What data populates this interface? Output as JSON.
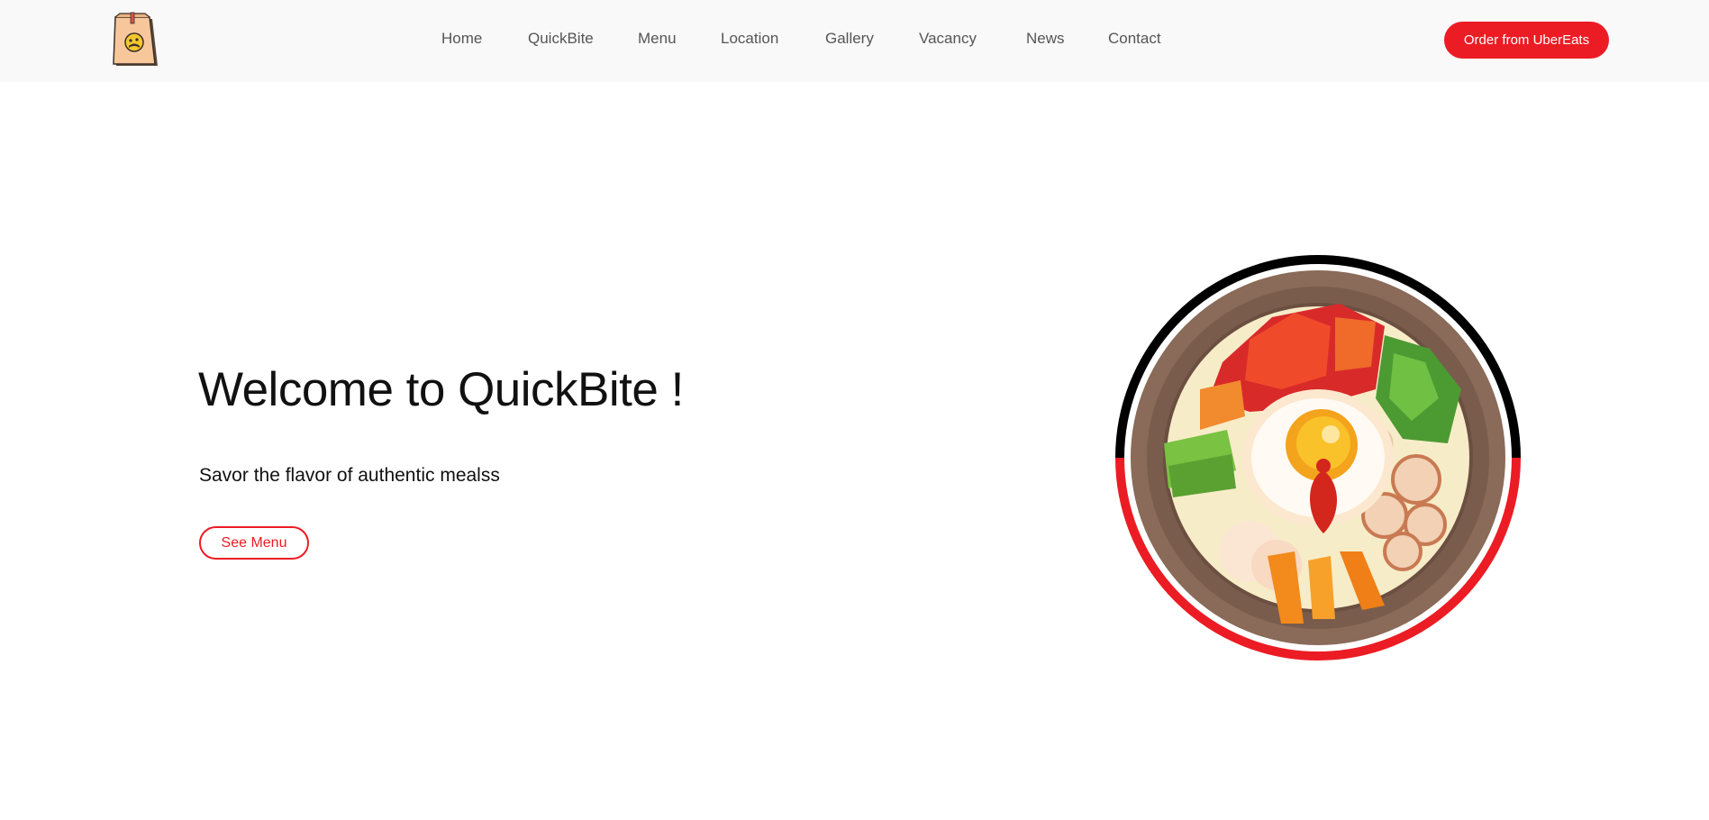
{
  "nav": {
    "logo_icon": "paper-bag-logo-icon",
    "links": [
      {
        "label": "Home"
      },
      {
        "label": "QuickBite"
      },
      {
        "label": "Menu"
      },
      {
        "label": "Location"
      },
      {
        "label": "Gallery"
      },
      {
        "label": "Vacancy"
      },
      {
        "label": "News"
      },
      {
        "label": "Contact"
      }
    ],
    "order_label": "Order from UberEats"
  },
  "hero": {
    "title": "Welcome to QuickBite !",
    "subtitle": "Savor the flavor of authentic mealss",
    "menu_label": "See Menu",
    "image_icon": "bibimbap-bowl-illustration"
  },
  "colors": {
    "accent": "#ec1c24",
    "nav_background": "#f9f9f9",
    "nav_text": "#555555",
    "heading": "#111111"
  }
}
